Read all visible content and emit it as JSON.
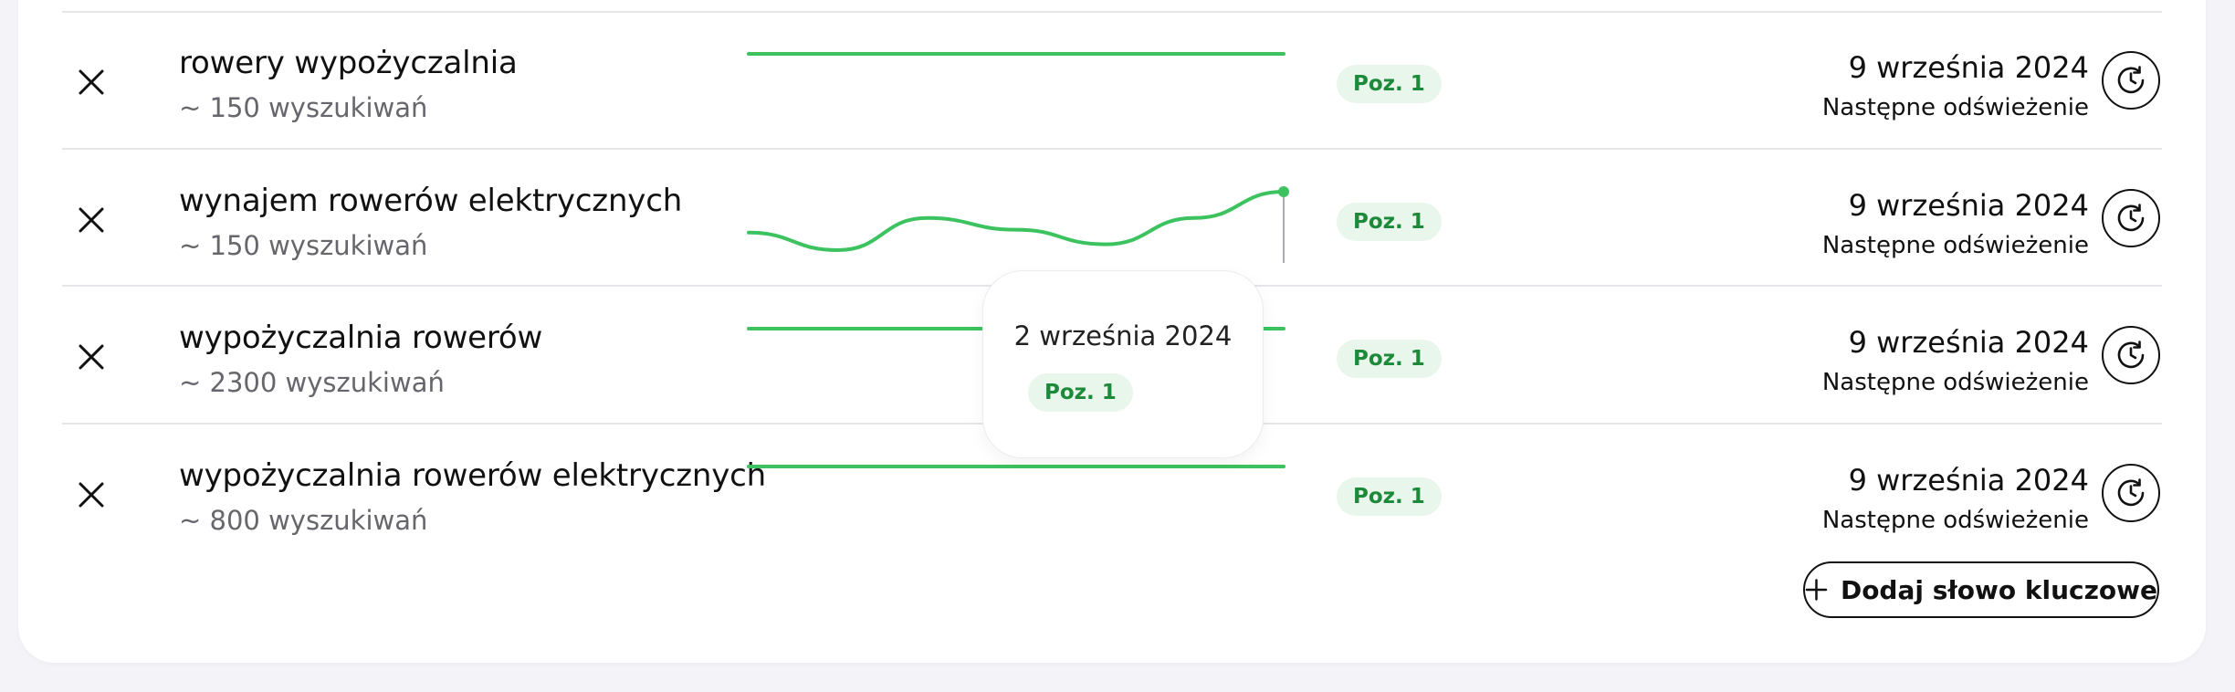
{
  "keywords": [
    {
      "name": "rowery wypożyczalnia",
      "volume": "~ 150 wyszukiwań",
      "position": "Poz. 1",
      "refresh_date": "9 września 2024",
      "refresh_label": "Następne odświeżenie",
      "trend": [
        1,
        1,
        1,
        1,
        1,
        1,
        1,
        1
      ]
    },
    {
      "name": "wynajem rowerów elektrycznych",
      "volume": "~ 150 wyszukiwań",
      "position": "Poz. 1",
      "refresh_date": "9 września 2024",
      "refresh_label": "Następne odświeżenie",
      "trend": [
        0.3,
        0,
        0.55,
        0.35,
        0.1,
        0.55,
        1
      ]
    },
    {
      "name": "wypożyczalnia rowerów",
      "volume": "~ 2300 wyszukiwań",
      "position": "Poz. 1",
      "refresh_date": "9 września 2024",
      "refresh_label": "Następne odświeżenie",
      "trend": [
        1,
        1,
        1,
        1,
        1,
        1,
        1,
        1
      ]
    },
    {
      "name": "wypożyczalnia rowerów elektrycznych",
      "volume": "~ 800 wyszukiwań",
      "position": "Poz. 1",
      "refresh_date": "9 września 2024",
      "refresh_label": "Następne odświeżenie",
      "trend": [
        1,
        1,
        1,
        1,
        1,
        1,
        1,
        1
      ]
    }
  ],
  "tooltip": {
    "date": "2 września 2024",
    "position": "Poz. 1"
  },
  "add_button": {
    "label": "Dodaj słowo kluczowe",
    "icon": "plus-icon"
  },
  "icons": {
    "remove": "close-icon",
    "refresh": "clock-refresh-icon"
  },
  "colors": {
    "trend_line": "#3cc35f",
    "badge_bg": "#e9f6ec",
    "badge_text": "#1d8a3a",
    "page_bg": "#f4f4f8"
  }
}
